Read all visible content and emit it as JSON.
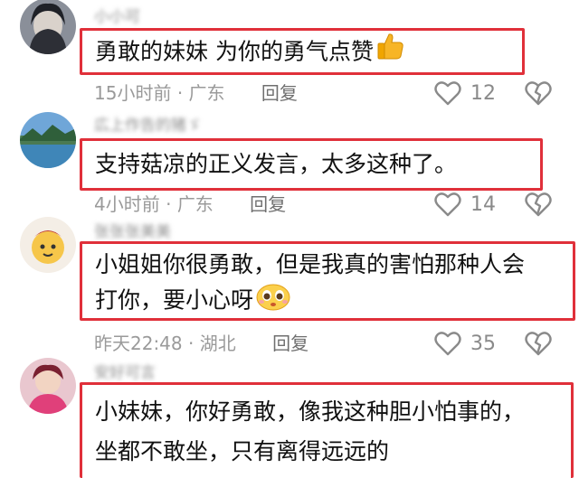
{
  "comments": [
    {
      "username": "小小可",
      "text": "勇敢的妹妹 为你的勇气点赞",
      "emoji": "thumbs-up",
      "time": "15小时前",
      "location": "广东",
      "reply_label": "回复",
      "likes": "12"
    },
    {
      "username": "広上作告的猪ゞ",
      "text": "支持菇凉的正义发言，太多这种了。",
      "time": "4小时前",
      "location": "广东",
      "reply_label": "回复",
      "likes": "14"
    },
    {
      "username": "张张张美美",
      "text_line1": "小姐姐你很勇敢，但是我真的害怕那种人会",
      "text_line2": "打你，要小心呀",
      "emoji": "teary-face",
      "time": "昨天22:48",
      "location": "湖北",
      "reply_label": "回复",
      "likes": "35"
    },
    {
      "username": "安好可言",
      "text_line1": "小妹妹，你好勇敢，像我这种胆小怕事的，",
      "text_line2": "坐都不敢坐，只有离得远远的"
    }
  ],
  "colors": {
    "highlight_border": "#e0303a",
    "meta_text": "#9a9a9a",
    "icon": "#8a8a8a"
  },
  "icons": {
    "like": "heart-icon",
    "dislike": "broken-heart-icon"
  }
}
